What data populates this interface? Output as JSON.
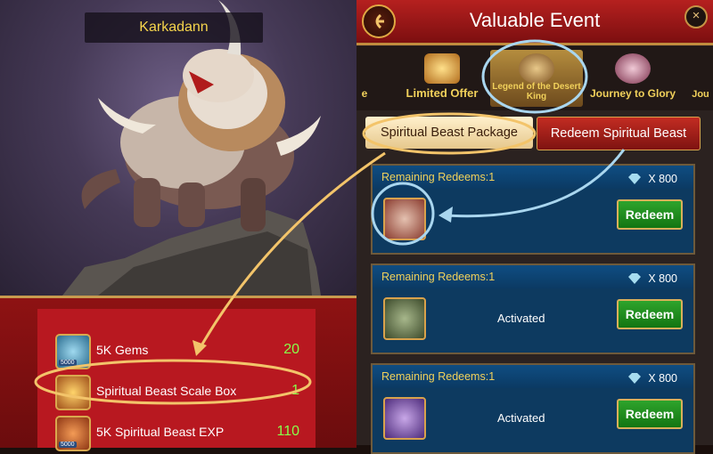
{
  "beast": {
    "name": "Karkadann"
  },
  "rewards": [
    {
      "label": "5K Gems",
      "qty": "20",
      "icon": "gem-pack-icon",
      "badge": "5000"
    },
    {
      "label": "Spiritual Beast Scale Box",
      "qty": "1",
      "icon": "scale-box-icon"
    },
    {
      "label": "5K Spiritual Beast EXP",
      "qty": "110",
      "icon": "beast-exp-icon",
      "badge": "5000"
    }
  ],
  "event": {
    "title": "Valuable Event",
    "tabs": [
      {
        "label": "e"
      },
      {
        "label": "Limited Offer"
      },
      {
        "label": "Legend of the Desert King"
      },
      {
        "label": "Journey to Glory"
      },
      {
        "label": "Jou"
      }
    ],
    "sub_tabs": [
      {
        "label": "Spiritual Beast Package"
      },
      {
        "label": "Redeem Spiritual Beast"
      }
    ],
    "cards": [
      {
        "remaining": "Remaining Redeems:1",
        "cost": "X 800",
        "status": "",
        "button": "Redeem"
      },
      {
        "remaining": "Remaining Redeems:1",
        "cost": "X 800",
        "status": "Activated",
        "button": "Redeem"
      },
      {
        "remaining": "Remaining Redeems:1",
        "cost": "X 800",
        "status": "Activated",
        "button": "Redeem"
      }
    ]
  },
  "colors": {
    "accent_gold": "#f5d44c",
    "qty_green": "#88ff4a",
    "annotation": "#f3c46a",
    "highlight_blue": "#a9d6ef"
  }
}
